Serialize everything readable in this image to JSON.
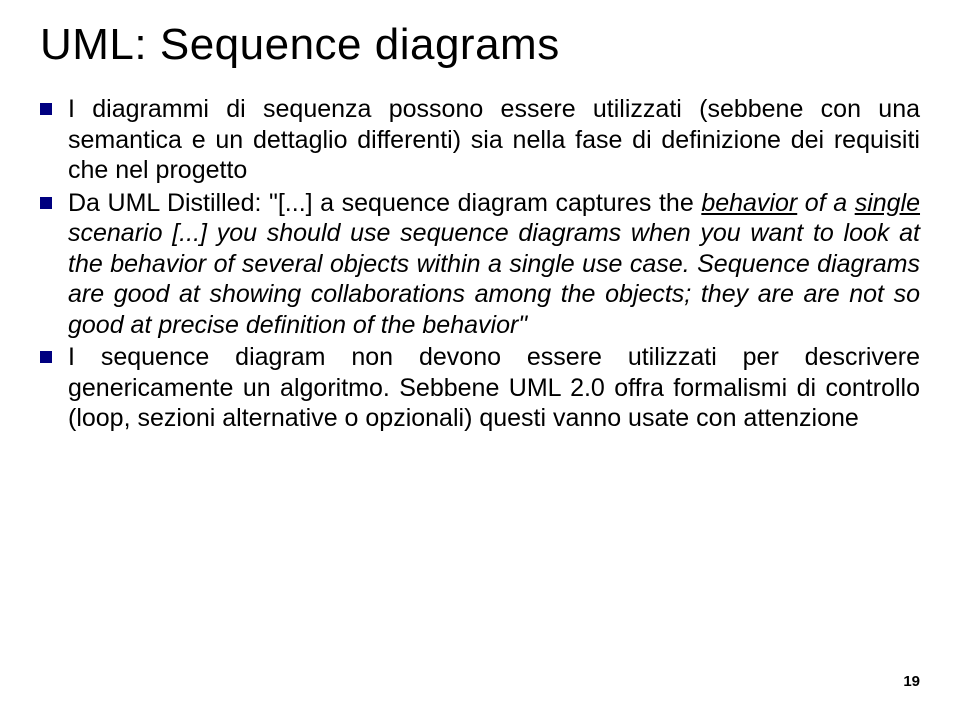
{
  "title": "UML: Sequence diagrams",
  "bullets": {
    "b1": "I diagrammi di sequenza possono essere utilizzati (sebbene con una semantica e un dettaglio differenti) sia nella fase di definizione dei requisiti che nel progetto",
    "b2_pre": "Da UML Distilled: \"[...] a sequence diagram captures the ",
    "b2_u1": "behavior",
    "b2_mid1": " of a ",
    "b2_u2": "single",
    "b2_mid2": " scenario [...] you should use sequence diagrams when you want to look at the behavior of several objects within a single use case. Sequence diagrams are good at showing collaborations among the objects; they are are not so good at precise definition of the behavior\"",
    "b3": "I sequence diagram non devono essere utilizzati per descrivere genericamente un algoritmo. Sebbene UML 2.0 offra formalismi di controllo (loop, sezioni alternative o opzionali) questi vanno usate con attenzione"
  },
  "page_number": "19"
}
